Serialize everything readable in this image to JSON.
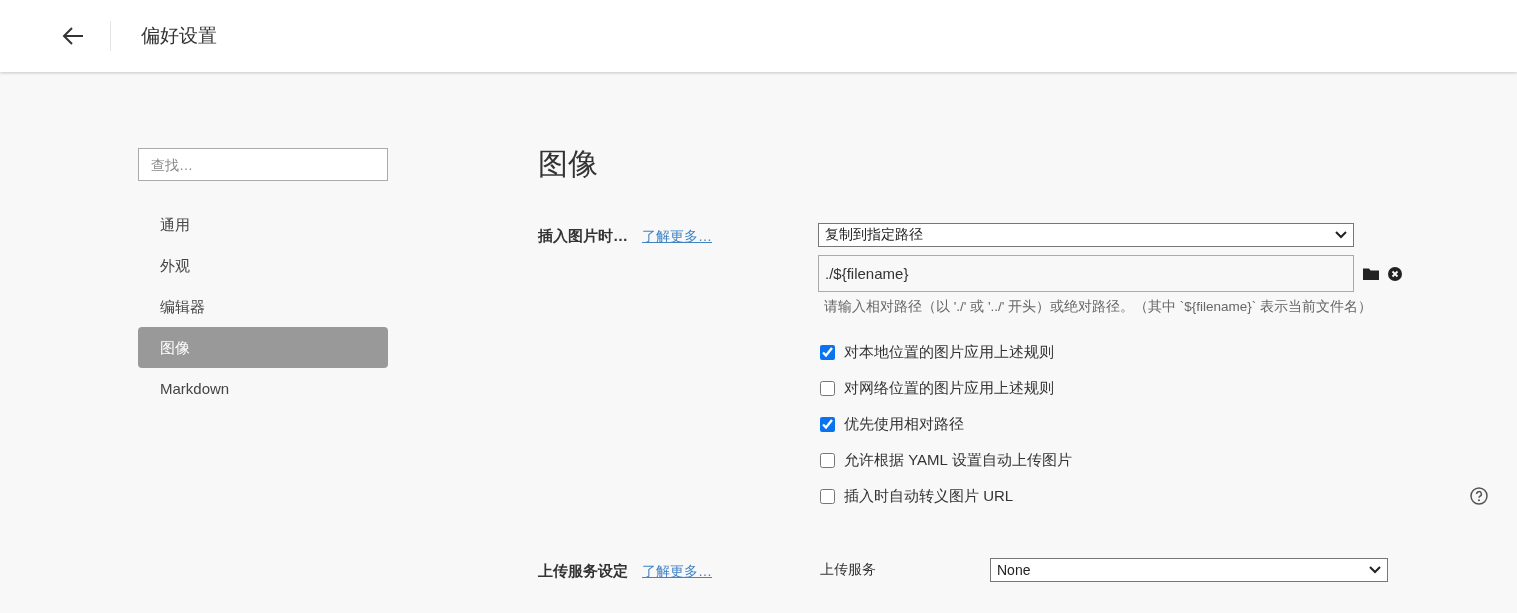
{
  "header": {
    "title": "偏好设置"
  },
  "sidebar": {
    "search": {
      "placeholder": "查找…"
    },
    "items": [
      {
        "label": "通用",
        "selected": false
      },
      {
        "label": "外观",
        "selected": false
      },
      {
        "label": "编辑器",
        "selected": false
      },
      {
        "label": "图像",
        "selected": true
      },
      {
        "label": "Markdown",
        "selected": false
      }
    ]
  },
  "content": {
    "title": "图像",
    "insert_section": {
      "label": "插入图片时…",
      "link": "了解更多…",
      "dropdown": "复制到指定路径",
      "path_field": "./${filename}",
      "hint": "请输入相对路径（以 './' 或 '../' 开头）或绝对路径。（其中 `${filename}` 表示当前文件名）",
      "options": [
        {
          "label": "对本地位置的图片应用上述规则",
          "checked": true
        },
        {
          "label": "对网络位置的图片应用上述规则",
          "checked": false
        },
        {
          "label": "优先使用相对路径",
          "checked": true
        },
        {
          "label": "允许根据 YAML 设置自动上传图片",
          "checked": false
        },
        {
          "label": "插入时自动转义图片 URL",
          "checked": false
        }
      ]
    },
    "upload_section": {
      "label": "上传服务设定",
      "link": "了解更多…",
      "field_label": "上传服务",
      "dropdown": "None"
    }
  }
}
